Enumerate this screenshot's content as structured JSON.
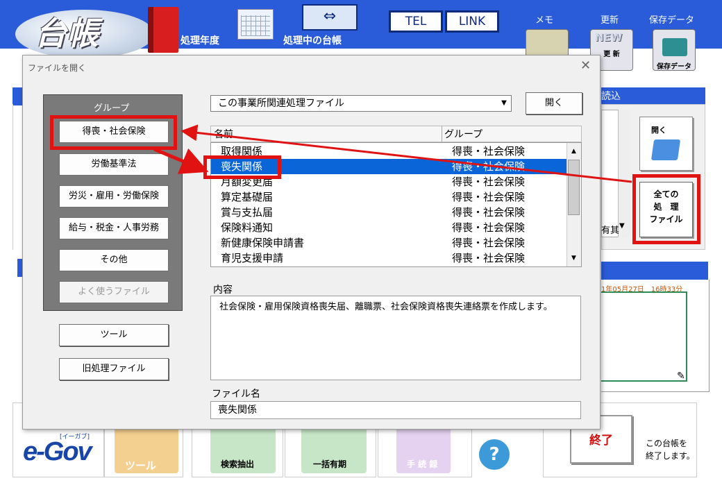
{
  "app": {
    "logo": "台帳",
    "fiscal_year_label": "処理年度",
    "current_ledger_label": "処理中の台帳",
    "arrow_symbol": "⇔",
    "tel_label": "TEL",
    "link_label": "LINK",
    "memo_label": "メモ",
    "update_label": "更新",
    "saved_data_label": "保存データ",
    "update_icon_new": "NEW",
    "update_icon_text": "更 新",
    "save_icon_text": "保存データ"
  },
  "right_panel": {
    "header_fragment": "読込",
    "open_label": "開く",
    "all_files_line1": "全ての",
    "all_files_line2": "処　理",
    "all_files_line3": "ファイル",
    "dropdown_fragment": "有其",
    "date_fragment": "1年05月27日　16時33分"
  },
  "bottom": {
    "egov": "e-Gov",
    "egov_small": "[イーガブ]",
    "tool_label": "ツール",
    "search_label": "検索抽出",
    "bulk_label": "一括有期",
    "procedure_label": "手 続 録",
    "help_icon": "?",
    "exit_label": "終了",
    "exit_desc_line1": "この台帳を",
    "exit_desc_line2": "終了します。"
  },
  "dialog": {
    "title": "ファイルを開く",
    "close": "✕",
    "group_title": "グループ",
    "group_buttons": [
      "得喪・社会保険",
      "労働基準法",
      "労災・雇用・労働保険",
      "給与・税金・人事労務",
      "その他",
      "よく使うファイル"
    ],
    "tools_button": "ツール",
    "old_files_button": "旧処理ファイル",
    "filter_value": "この事業所関連処理ファイル",
    "open_button": "開く",
    "col_name": "名前",
    "col_group": "グループ",
    "rows": [
      {
        "name": "取得関係",
        "group": "得喪・社会保険"
      },
      {
        "name": "喪失関係",
        "group": "得喪・社会保険"
      },
      {
        "name": "月額変更届",
        "group": "得喪・社会保険"
      },
      {
        "name": "算定基礎届",
        "group": "得喪・社会保険"
      },
      {
        "name": "賞与支払届",
        "group": "得喪・社会保険"
      },
      {
        "name": "保険料通知",
        "group": "得喪・社会保険"
      },
      {
        "name": "新健康保険申請書",
        "group": "得喪・社会保険"
      },
      {
        "name": "育児支援申請",
        "group": "得喪・社会保険"
      }
    ],
    "selected_row": "喪失関係",
    "desc_label": "内容",
    "description": "社会保険・雇用保険資格喪失届、離職票、社会保険資格喪失連絡票を作成します。",
    "filename_label": "ファイル名",
    "filename_value": "喪失関係"
  },
  "annotation": {
    "color": "#e01212"
  }
}
